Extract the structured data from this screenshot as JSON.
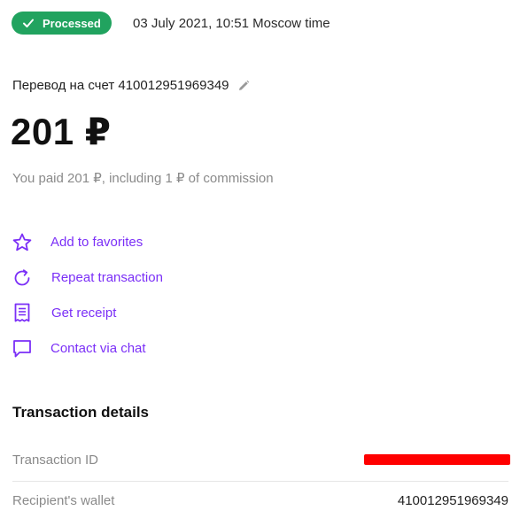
{
  "header": {
    "status_label": "Processed",
    "status_icon": "check-icon",
    "datetime": "03 July 2021, 10:51 Moscow time"
  },
  "transfer": {
    "title": "Перевод на счет 410012951969349",
    "edit_icon": "pencil-icon"
  },
  "amount": "201 ₽",
  "paid_note": "You paid 201 ₽, including 1 ₽ of commission",
  "actions": [
    {
      "label": "Add to favorites",
      "icon": "star-icon"
    },
    {
      "label": "Repeat transaction",
      "icon": "repeat-icon"
    },
    {
      "label": "Get receipt",
      "icon": "receipt-icon"
    },
    {
      "label": "Contact via chat",
      "icon": "chat-icon"
    }
  ],
  "details": {
    "title": "Transaction details",
    "rows": [
      {
        "label": "Transaction ID",
        "value": ""
      },
      {
        "label": "Recipient's wallet",
        "value": "410012951969349"
      }
    ]
  },
  "colors": {
    "status_green": "#21a35f",
    "accent_purple": "#7b2ff7",
    "redaction_red": "#ff0000"
  }
}
